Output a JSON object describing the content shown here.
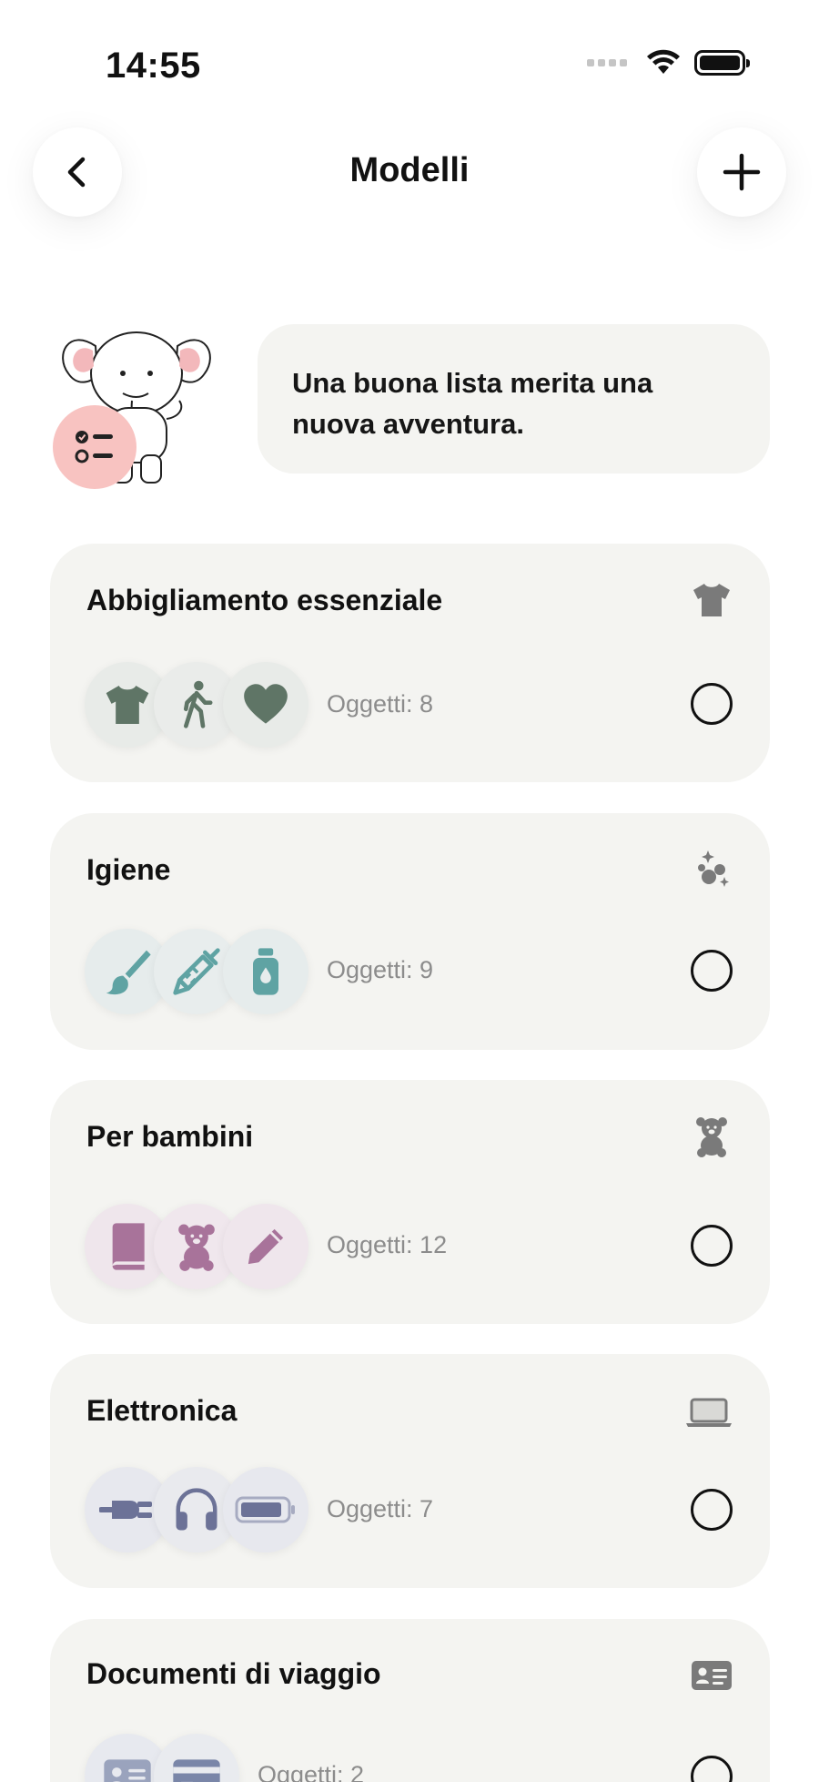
{
  "status": {
    "time": "14:55"
  },
  "header": {
    "title": "Modelli",
    "back_icon": "chevron-left-icon",
    "add_icon": "plus-icon"
  },
  "banner": {
    "message": "Una buona lista merita una nuova avventura.",
    "mascot": "elephant-mascot",
    "badge_icon": "checklist-icon",
    "badge_color": "#f8c3c1"
  },
  "templates": [
    {
      "title": "Abbigliamento essenziale",
      "count": "Oggetti: 8",
      "category_icon": "tshirt-icon",
      "item_icons": [
        "tshirt-icon",
        "walking-person-icon",
        "heart-icon"
      ],
      "accent": "#5f7566"
    },
    {
      "title": "Igiene",
      "count": "Oggetti: 9",
      "category_icon": "bubbles-sparkle-icon",
      "item_icons": [
        "brush-icon",
        "syringe-icon",
        "bottle-icon"
      ],
      "accent": "#5fa3a3"
    },
    {
      "title": "Per bambini",
      "count": "Oggetti: 12",
      "category_icon": "teddy-bear-icon",
      "item_icons": [
        "book-icon",
        "teddy-bear-icon",
        "pencil-icon"
      ],
      "accent": "#a8739a"
    },
    {
      "title": "Elettronica",
      "count": "Oggetti: 7",
      "category_icon": "laptop-icon",
      "item_icons": [
        "plug-icon",
        "headphones-icon",
        "battery-icon"
      ],
      "accent": "#6c7297"
    },
    {
      "title": "Documenti di viaggio",
      "count": "Oggetti: 2",
      "category_icon": "id-card-icon",
      "item_icons": [
        "id-card-icon",
        "credit-card-icon"
      ],
      "accent": "#7a86a8"
    }
  ]
}
